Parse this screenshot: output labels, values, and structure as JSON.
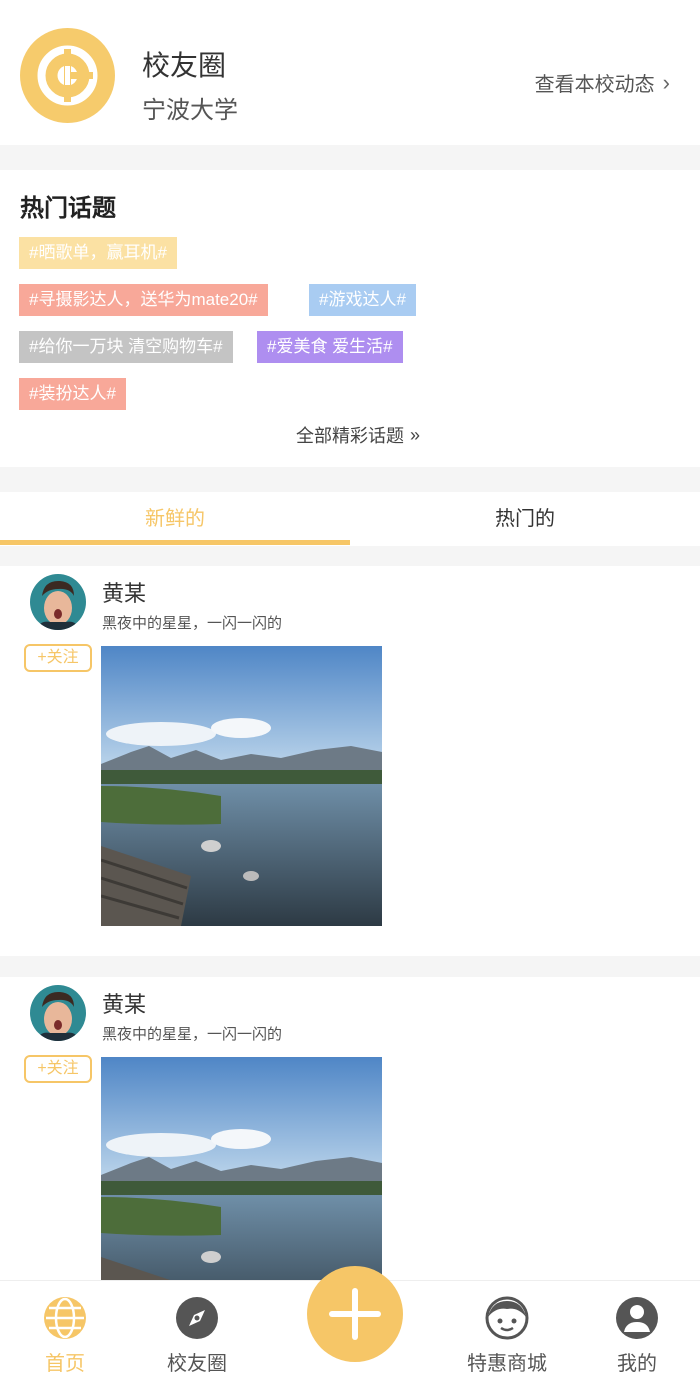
{
  "header": {
    "app_title": "校友圈",
    "school_name": "宁波大学",
    "view_school_label": "查看本校动态"
  },
  "topics": {
    "title": "热门话题",
    "tags": [
      {
        "label": "#晒歌单，赢耳机#",
        "color": "#fbe1a3"
      },
      {
        "label": "#寻摄影达人，送华为mate20#",
        "color": "#f8a899"
      },
      {
        "label": "#游戏达人#",
        "color": "#a9ccf2"
      },
      {
        "label": "#给你一万块 清空购物车#",
        "color": "#c4c4c4"
      },
      {
        "label": "#爱美食 爱生活#",
        "color": "#ae8ef0"
      },
      {
        "label": "#装扮达人#",
        "color": "#f8a899"
      }
    ],
    "all_topics_label": "全部精彩话题"
  },
  "tabs": [
    {
      "label": "新鲜的",
      "active": true
    },
    {
      "label": "热门的",
      "active": false
    }
  ],
  "posts": [
    {
      "author": "黄某",
      "text": "黑夜中的星星，一闪一闪的",
      "follow_label": "+关注"
    },
    {
      "author": "黄某",
      "text": "黑夜中的星星，一闪一闪的",
      "follow_label": "+关注"
    }
  ],
  "bottom_nav": [
    {
      "label": "首页",
      "icon": "globe-icon",
      "active": true
    },
    {
      "label": "校友圈",
      "icon": "compass-icon",
      "active": false
    },
    {
      "label": "",
      "icon": "plus-icon",
      "active": false
    },
    {
      "label": "特惠商城",
      "icon": "face-icon",
      "active": false
    },
    {
      "label": "我的",
      "icon": "user-icon",
      "active": false
    }
  ],
  "colors": {
    "accent": "#f6c667",
    "tag_yellow": "#fbe1a3",
    "tag_salmon": "#f8a899",
    "tag_blue": "#a9ccf2",
    "tag_gray": "#c4c4c4",
    "tag_purple": "#ae8ef0"
  }
}
